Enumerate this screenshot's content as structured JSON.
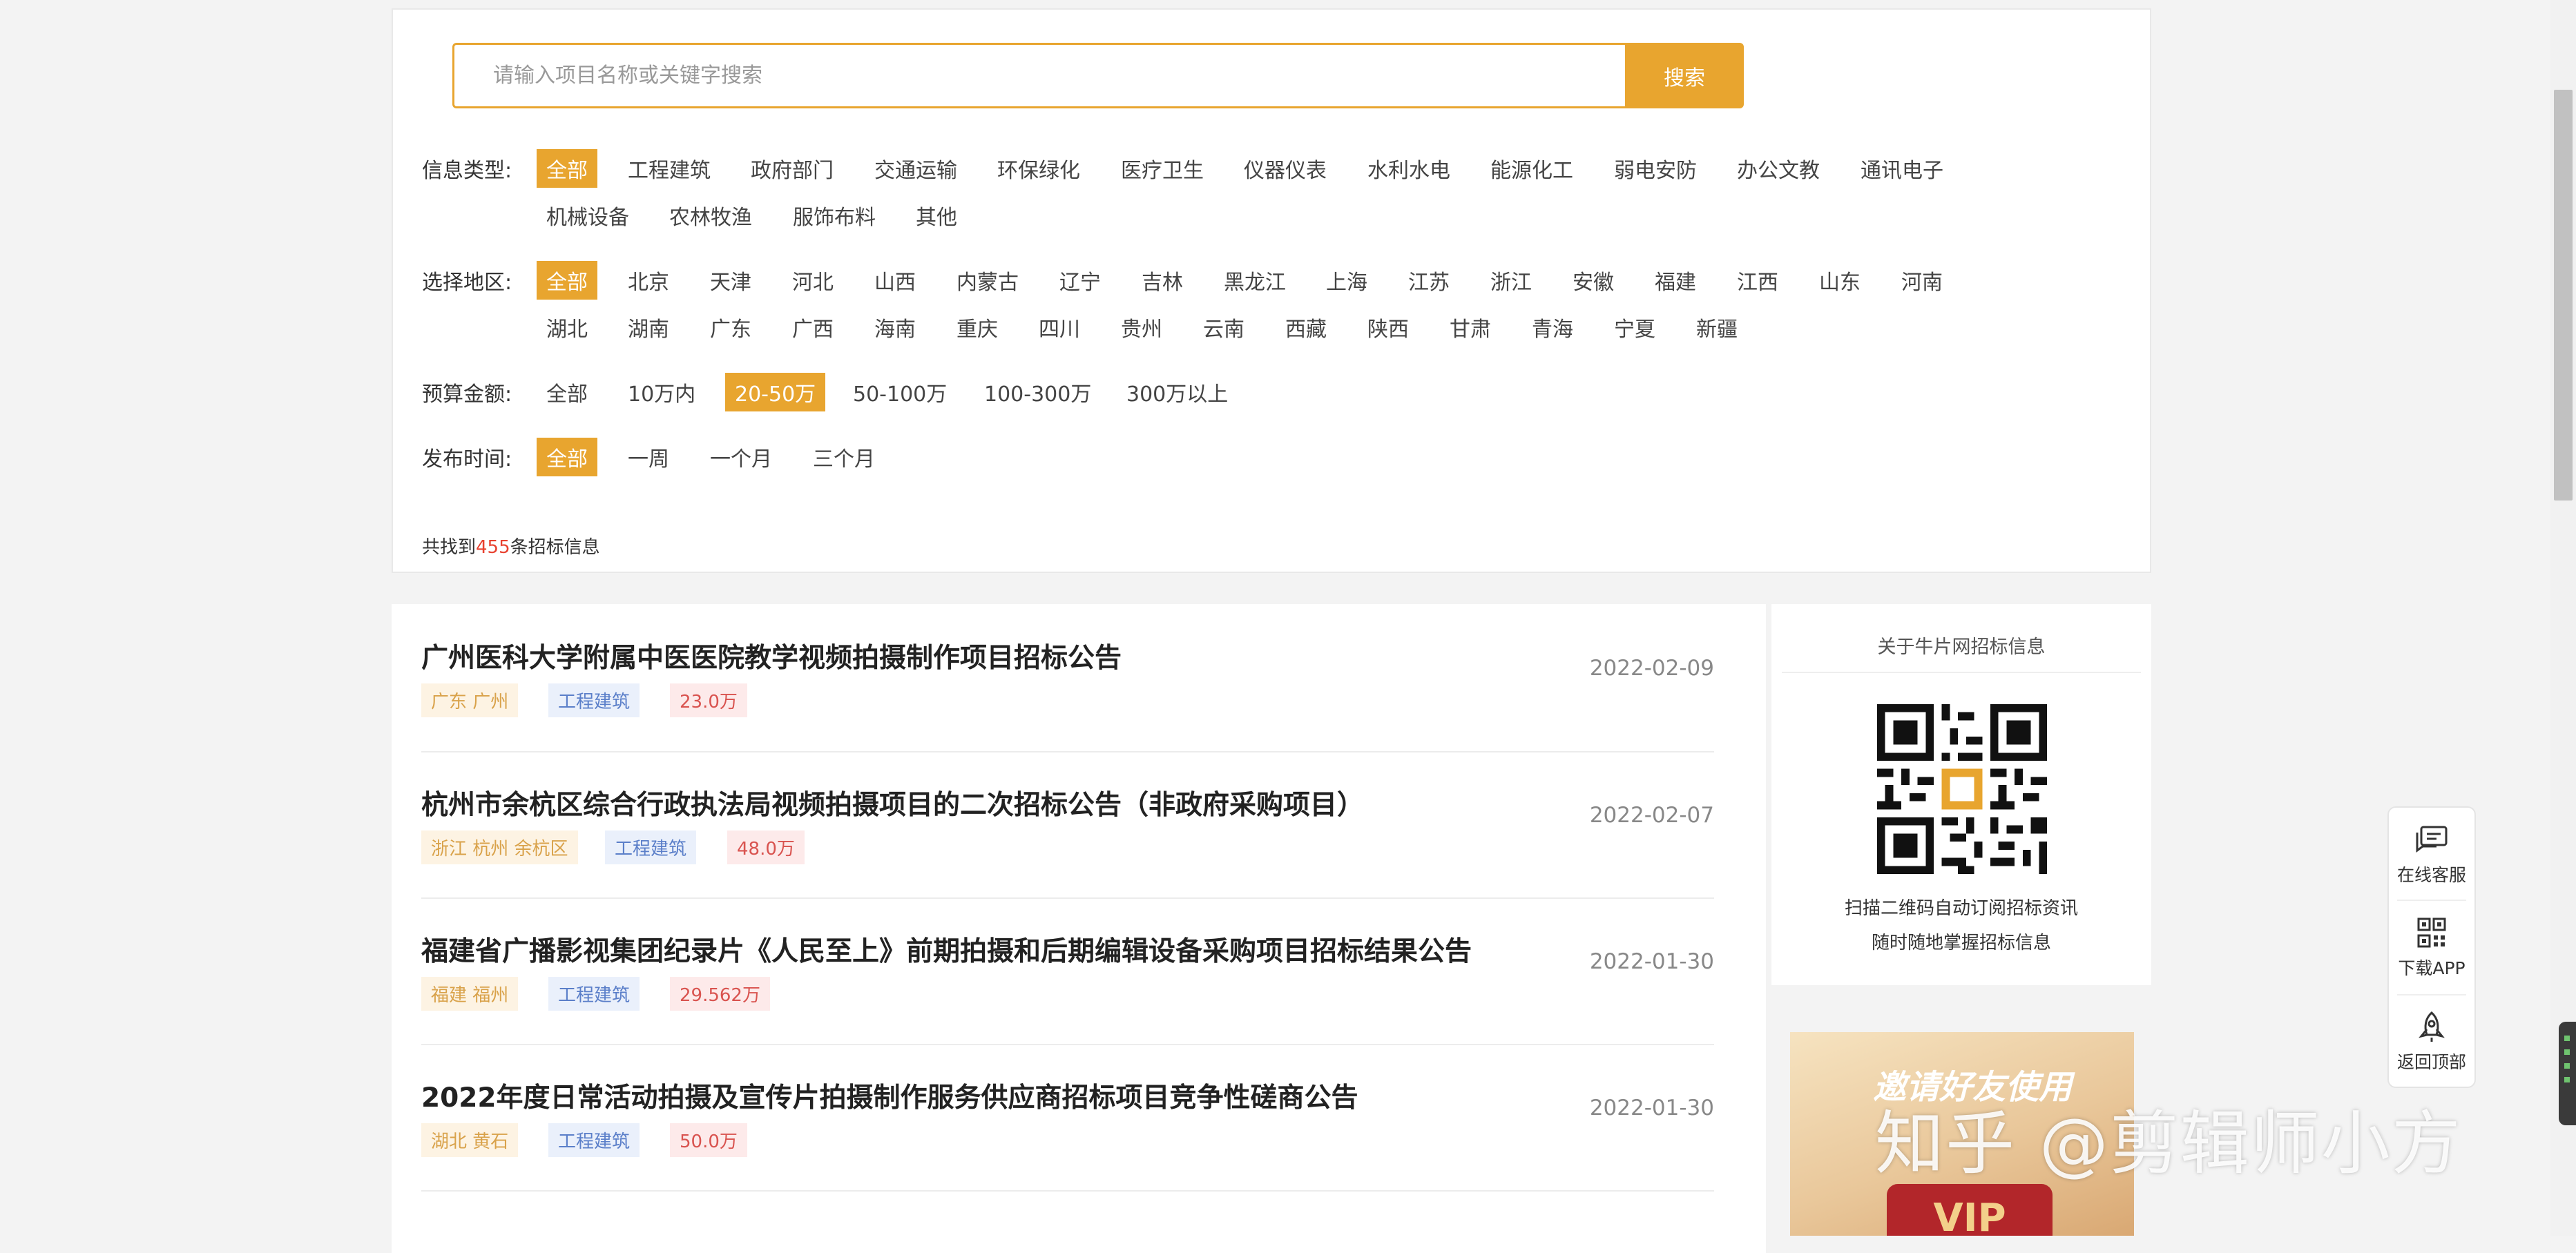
{
  "search": {
    "placeholder": "请输入项目名称或关键字搜索",
    "button_label": "搜索"
  },
  "filters": {
    "info_type": {
      "label": "信息类型:",
      "options": [
        "全部",
        "工程建筑",
        "政府部门",
        "交通运输",
        "环保绿化",
        "医疗卫生",
        "仪器仪表",
        "水利水电",
        "能源化工",
        "弱电安防",
        "办公文教",
        "通讯电子",
        "机械设备",
        "农林牧渔",
        "服饰布料",
        "其他"
      ],
      "active": "全部"
    },
    "region": {
      "label": "选择地区:",
      "options": [
        "全部",
        "北京",
        "天津",
        "河北",
        "山西",
        "内蒙古",
        "辽宁",
        "吉林",
        "黑龙江",
        "上海",
        "江苏",
        "浙江",
        "安徽",
        "福建",
        "江西",
        "山东",
        "河南",
        "湖北",
        "湖南",
        "广东",
        "广西",
        "海南",
        "重庆",
        "四川",
        "贵州",
        "云南",
        "西藏",
        "陕西",
        "甘肃",
        "青海",
        "宁夏",
        "新疆"
      ],
      "active": "全部"
    },
    "budget": {
      "label": "预算金额:",
      "options": [
        "全部",
        "10万内",
        "20-50万",
        "50-100万",
        "100-300万",
        "300万以上"
      ],
      "active": "20-50万"
    },
    "publish_time": {
      "label": "发布时间:",
      "options": [
        "全部",
        "一周",
        "一个月",
        "三个月"
      ],
      "active": "全部"
    }
  },
  "results": {
    "prefix": "共找到",
    "count": "455",
    "suffix": "条招标信息"
  },
  "listings": [
    {
      "title": "广州医科大学附属中医医院教学视频拍摄制作项目招标公告",
      "region": "广东 广州",
      "category": "工程建筑",
      "amount": "23.0万",
      "date": "2022-02-09"
    },
    {
      "title": "杭州市余杭区综合行政执法局视频拍摄项目的二次招标公告（非政府采购项目）",
      "region": "浙江 杭州 余杭区",
      "category": "工程建筑",
      "amount": "48.0万",
      "date": "2022-02-07"
    },
    {
      "title": "福建省广播影视集团纪录片《人民至上》前期拍摄和后期编辑设备采购项目招标结果公告",
      "region": "福建 福州",
      "category": "工程建筑",
      "amount": "29.562万",
      "date": "2022-01-30"
    },
    {
      "title": "2022年度日常活动拍摄及宣传片拍摄制作服务供应商招标项目竞争性磋商公告",
      "region": "湖北 黄石",
      "category": "工程建筑",
      "amount": "50.0万",
      "date": "2022-01-30"
    }
  ],
  "sidebar": {
    "title": "关于牛片网招标信息",
    "qr_line1": "扫描二维码自动订阅招标资讯",
    "qr_line2": "随时随地掌握招标信息",
    "banner_title": "邀请好友使用",
    "banner_badge": "VIP"
  },
  "float_bar": {
    "service": "在线客服",
    "download": "下载APP",
    "top": "返回顶部"
  },
  "watermark": "知乎 @剪辑师小方",
  "colors": {
    "accent": "#e8a52f",
    "count": "#e8412f"
  }
}
